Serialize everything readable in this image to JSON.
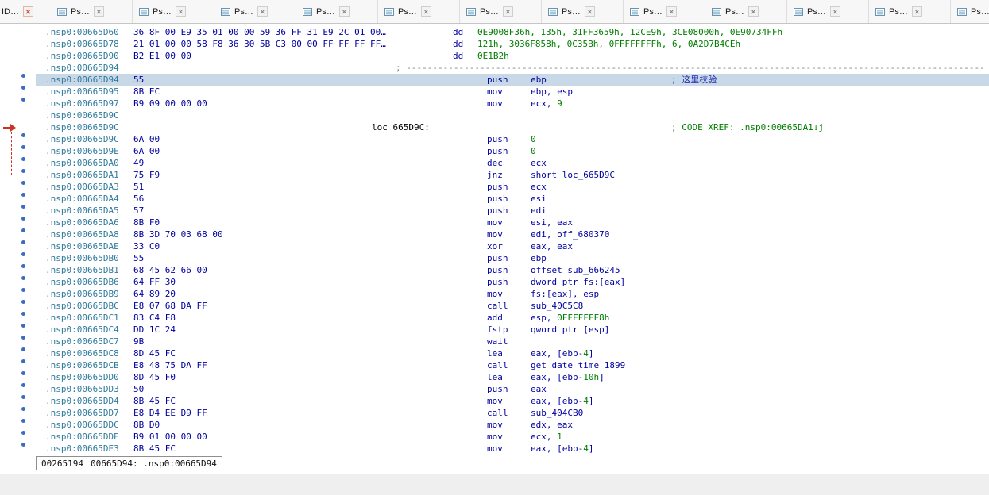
{
  "tab_bar": {
    "first_tab": {
      "label": "ID…"
    },
    "close_glyph": "✕",
    "tabs": [
      {
        "label": "Ps…"
      },
      {
        "label": "Ps…"
      },
      {
        "label": "Ps…"
      },
      {
        "label": "Ps…"
      },
      {
        "label": "Ps…"
      },
      {
        "label": "Ps…"
      },
      {
        "label": "Ps…"
      },
      {
        "label": "Ps…"
      },
      {
        "label": "Ps…"
      },
      {
        "label": "Ps…"
      },
      {
        "label": "Ps…"
      },
      {
        "label": "Ps…"
      }
    ]
  },
  "icons": {
    "tab_icon": "listing-icon",
    "close_icon": "close-icon",
    "margin_dot": "address-dot",
    "jump_marker": "jump-arrow-icon"
  },
  "colors": {
    "code": "#0000a0",
    "num": "#007d00",
    "addr": "#2e7a9c",
    "ucmt": "#1c2bb0",
    "xref": "#007d00",
    "sepc": "#808080",
    "hlbg": "#c9d8e6",
    "dotc": "#3d6bbf",
    "jmpc": "#cc3322"
  },
  "listing": {
    "rows": [
      {
        "k": "data",
        "a": ".nsp0:00665D60",
        "b": "36 8F 00 E9 35 01 00 00 59 36 FF 31 E9 2C 01 00…",
        "m": "dd",
        "o": [
          [
            "0E9008F36h, 135h, 31FF3659h, 12CE9h, 3CE08000h, 0E90734FFh",
            "num"
          ]
        ]
      },
      {
        "k": "data",
        "a": ".nsp0:00665D78",
        "b": "21 01 00 00 58 F8 36 30 5B C3 00 00 FF FF FF FF…",
        "m": "dd",
        "o": [
          [
            "121h, 3036F858h, 0C35Bh, 0FFFFFFFFh, 6, 0A2D7B4CEh",
            "num"
          ]
        ]
      },
      {
        "k": "data",
        "a": ".nsp0:00665D90",
        "b": "B2 E1 00 00",
        "m": "dd",
        "o": [
          [
            "0E1B2h",
            "num"
          ]
        ]
      },
      {
        "k": "sep",
        "a": ".nsp0:00665D94",
        "s": "; --------------------------------------------------------------------------------------------------------------"
      },
      {
        "k": "code",
        "a": ".nsp0:00665D94",
        "b": "55",
        "m": "push",
        "o": [
          [
            "ebp",
            "code"
          ]
        ],
        "c": [
          "; 这里校验",
          "user"
        ],
        "hl": true,
        "dot": true
      },
      {
        "k": "code",
        "a": ".nsp0:00665D95",
        "b": "8B EC",
        "m": "mov",
        "o": [
          [
            "ebp, esp",
            "code"
          ]
        ],
        "dot": true
      },
      {
        "k": "code",
        "a": ".nsp0:00665D97",
        "b": "B9 09 00 00 00",
        "m": "mov",
        "o": [
          [
            "ecx, ",
            "code"
          ],
          [
            "9",
            "num"
          ]
        ],
        "dot": true
      },
      {
        "k": "blank",
        "a": ".nsp0:00665D9C"
      },
      {
        "k": "label",
        "a": ".nsp0:00665D9C",
        "lab": "loc_665D9C:",
        "c": [
          "; CODE XREF: .nsp0:00665DA1↓j",
          "xref"
        ]
      },
      {
        "k": "code",
        "a": ".nsp0:00665D9C",
        "b": "6A 00",
        "m": "push",
        "o": [
          [
            "0",
            "num"
          ]
        ],
        "dot": true
      },
      {
        "k": "code",
        "a": ".nsp0:00665D9E",
        "b": "6A 00",
        "m": "push",
        "o": [
          [
            "0",
            "num"
          ]
        ],
        "dot": true
      },
      {
        "k": "code",
        "a": ".nsp0:00665DA0",
        "b": "49",
        "m": "dec",
        "o": [
          [
            "ecx",
            "code"
          ]
        ],
        "dot": true
      },
      {
        "k": "code",
        "a": ".nsp0:00665DA1",
        "b": "75 F9",
        "m": "jnz",
        "o": [
          [
            "short loc_665D9C",
            "code"
          ]
        ],
        "dot": true
      },
      {
        "k": "code",
        "a": ".nsp0:00665DA3",
        "b": "51",
        "m": "push",
        "o": [
          [
            "ecx",
            "code"
          ]
        ],
        "dot": true
      },
      {
        "k": "code",
        "a": ".nsp0:00665DA4",
        "b": "56",
        "m": "push",
        "o": [
          [
            "esi",
            "code"
          ]
        ],
        "dot": true
      },
      {
        "k": "code",
        "a": ".nsp0:00665DA5",
        "b": "57",
        "m": "push",
        "o": [
          [
            "edi",
            "code"
          ]
        ],
        "dot": true
      },
      {
        "k": "code",
        "a": ".nsp0:00665DA6",
        "b": "8B F0",
        "m": "mov",
        "o": [
          [
            "esi, eax",
            "code"
          ]
        ],
        "dot": true
      },
      {
        "k": "code",
        "a": ".nsp0:00665DA8",
        "b": "8B 3D 70 03 68 00",
        "m": "mov",
        "o": [
          [
            "edi, off_680370",
            "code"
          ]
        ],
        "dot": true
      },
      {
        "k": "code",
        "a": ".nsp0:00665DAE",
        "b": "33 C0",
        "m": "xor",
        "o": [
          [
            "eax, eax",
            "code"
          ]
        ],
        "dot": true
      },
      {
        "k": "code",
        "a": ".nsp0:00665DB0",
        "b": "55",
        "m": "push",
        "o": [
          [
            "ebp",
            "code"
          ]
        ],
        "dot": true
      },
      {
        "k": "code",
        "a": ".nsp0:00665DB1",
        "b": "68 45 62 66 00",
        "m": "push",
        "o": [
          [
            "offset sub_666245",
            "code"
          ]
        ],
        "dot": true
      },
      {
        "k": "code",
        "a": ".nsp0:00665DB6",
        "b": "64 FF 30",
        "m": "push",
        "o": [
          [
            "dword ptr fs:[eax]",
            "code"
          ]
        ],
        "dot": true
      },
      {
        "k": "code",
        "a": ".nsp0:00665DB9",
        "b": "64 89 20",
        "m": "mov",
        "o": [
          [
            "fs:[eax], esp",
            "code"
          ]
        ],
        "dot": true
      },
      {
        "k": "code",
        "a": ".nsp0:00665DBC",
        "b": "E8 07 68 DA FF",
        "m": "call",
        "o": [
          [
            "sub_40C5C8",
            "code"
          ]
        ],
        "dot": true
      },
      {
        "k": "code",
        "a": ".nsp0:00665DC1",
        "b": "83 C4 F8",
        "m": "add",
        "o": [
          [
            "esp, ",
            "code"
          ],
          [
            "0FFFFFFF8h",
            "num"
          ]
        ],
        "dot": true
      },
      {
        "k": "code",
        "a": ".nsp0:00665DC4",
        "b": "DD 1C 24",
        "m": "fstp",
        "o": [
          [
            "qword ptr [esp]",
            "code"
          ]
        ],
        "dot": true
      },
      {
        "k": "code",
        "a": ".nsp0:00665DC7",
        "b": "9B",
        "m": "wait",
        "dot": true
      },
      {
        "k": "code",
        "a": ".nsp0:00665DC8",
        "b": "8D 45 FC",
        "m": "lea",
        "o": [
          [
            "eax, [ebp-",
            "code"
          ],
          [
            "4",
            "num"
          ],
          [
            "]",
            "code"
          ]
        ],
        "dot": true
      },
      {
        "k": "code",
        "a": ".nsp0:00665DCB",
        "b": "E8 48 75 DA FF",
        "m": "call",
        "o": [
          [
            "get_date_time_1899",
            "code"
          ]
        ],
        "dot": true
      },
      {
        "k": "code",
        "a": ".nsp0:00665DD0",
        "b": "8D 45 F0",
        "m": "lea",
        "o": [
          [
            "eax, [ebp-",
            "code"
          ],
          [
            "10h",
            "num"
          ],
          [
            "]",
            "code"
          ]
        ],
        "dot": true
      },
      {
        "k": "code",
        "a": ".nsp0:00665DD3",
        "b": "50",
        "m": "push",
        "o": [
          [
            "eax",
            "code"
          ]
        ],
        "dot": true
      },
      {
        "k": "code",
        "a": ".nsp0:00665DD4",
        "b": "8B 45 FC",
        "m": "mov",
        "o": [
          [
            "eax, [ebp-",
            "code"
          ],
          [
            "4",
            "num"
          ],
          [
            "]",
            "code"
          ]
        ],
        "dot": true
      },
      {
        "k": "code",
        "a": ".nsp0:00665DD7",
        "b": "E8 D4 EE D9 FF",
        "m": "call",
        "o": [
          [
            "sub_404CB0",
            "code"
          ]
        ],
        "dot": true
      },
      {
        "k": "code",
        "a": ".nsp0:00665DDC",
        "b": "8B D0",
        "m": "mov",
        "o": [
          [
            "edx, eax",
            "code"
          ]
        ],
        "dot": true
      },
      {
        "k": "code",
        "a": ".nsp0:00665DDE",
        "b": "B9 01 00 00 00",
        "m": "mov",
        "o": [
          [
            "ecx, ",
            "code"
          ],
          [
            "1",
            "num"
          ]
        ],
        "dot": true
      },
      {
        "k": "code",
        "a": ".nsp0:00665DE3",
        "b": "8B 45 FC",
        "m": "mov",
        "o": [
          [
            "eax, [ebp-",
            "code"
          ],
          [
            "4",
            "num"
          ],
          [
            "]",
            "code"
          ]
        ],
        "dot": true
      }
    ]
  },
  "status": {
    "offset": "00265194",
    "location": "00665D94: .nsp0:00665D94"
  }
}
